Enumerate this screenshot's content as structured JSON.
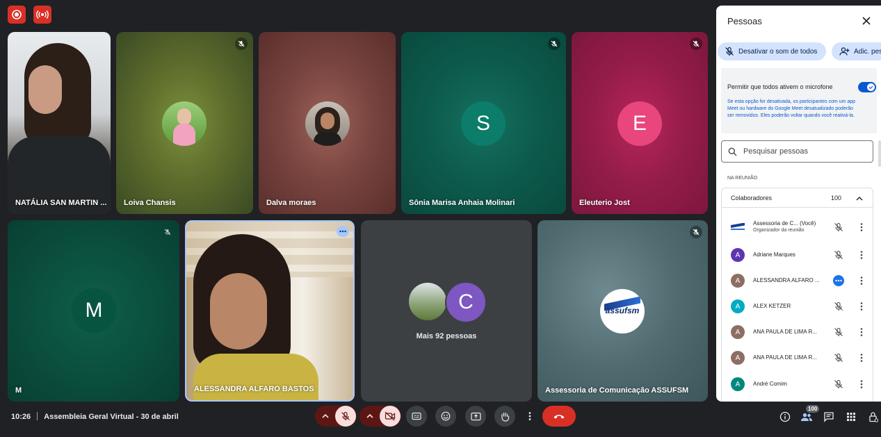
{
  "indicators": {
    "recording_icon": "record-icon",
    "live_icon": "broadcast-icon"
  },
  "tiles": {
    "natalia": {
      "name": "NATÁLIA SAN MARTIN ..."
    },
    "loiva": {
      "name": "Loiva Chansis"
    },
    "dalva": {
      "name": "Dalva moraes"
    },
    "sonia": {
      "name": "Sônia Marisa Anhaia Molinari",
      "initial": "S"
    },
    "eleuterio": {
      "name": "Eleuterio Jost",
      "initial": "E"
    },
    "m": {
      "name": "M",
      "initial": "M"
    },
    "alessandra": {
      "name": "ALESSANDRA ALFARO BASTOS"
    },
    "more": {
      "label": "Mais 92 pessoas",
      "initial": "C"
    },
    "assessoria": {
      "name": "Assessoria de Comunicação ASSUFSM",
      "logo_text": "assufsm"
    }
  },
  "bottom_bar": {
    "time": "10:26",
    "meeting_title": "Assembleia Geral Virtual - 30 de abril",
    "people_count": "100"
  },
  "panel": {
    "title": "Pessoas",
    "mute_all_label": "Desativar o som de todos",
    "add_people_label": "Adic. pes",
    "allow_mic_label": "Permitir que todos ativem o microfone",
    "allow_mic_help": "Se esta opção for desativada, os participantes com um app Meet ou hardware do Google Meet desatualizado poderão ser removidos. Eles poderão voltar quando você reativá-la.",
    "search_placeholder": "Pesquisar pessoas",
    "section_label": "NA REUNIÃO",
    "group_name": "Colaboradores",
    "group_count": "100",
    "participants": [
      {
        "name": "Assessoria de C... (Você)",
        "sub": "Organizador da reunião",
        "initial": ""
      },
      {
        "name": "Adriane Marques",
        "initial": "A"
      },
      {
        "name": "ALESSANDRA ALFARO ...",
        "initial": "A"
      },
      {
        "name": "ALEX KETZER",
        "initial": "A"
      },
      {
        "name": "ANA PAULA DE LIMA R...",
        "initial": "A"
      },
      {
        "name": "ANA PAULA DE LIMA R...",
        "initial": "A"
      },
      {
        "name": "André Comim",
        "initial": "A"
      }
    ]
  },
  "colors": {
    "leave": "#d93025",
    "accent": "#0b57d0",
    "panel_bg": "#ffffff",
    "meeting_bg": "#202124"
  }
}
